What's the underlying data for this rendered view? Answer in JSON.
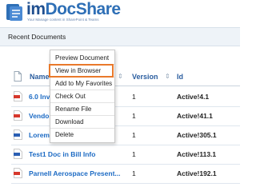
{
  "brand": {
    "name_prefix": "im",
    "name_rest": "DocShare",
    "tagline": "Your Manage content in SharePoint & Teams"
  },
  "breadcrumb": "Recent Documents",
  "table": {
    "columns": [
      "Name",
      "Version",
      "Id"
    ],
    "rows": [
      {
        "name": "6.0 Inve",
        "version": "1",
        "id": "Active!4.1"
      },
      {
        "name": "Vendor",
        "version": "1",
        "id": "Active!41.1"
      },
      {
        "name": "Lorem ip",
        "version": "1",
        "id": "Active!305.1"
      },
      {
        "name": "Test1 Doc in Bill Info",
        "version": "1",
        "id": "Active!113.1"
      },
      {
        "name": "Parnell Aerospace Present...",
        "version": "1",
        "id": "Active!192.1"
      }
    ]
  },
  "context_menu": {
    "items": [
      "Preview Document",
      "View in Browser",
      "Add to My Favorites",
      "Check Out",
      "Rename File",
      "Download",
      "Delete"
    ],
    "highlighted": "View in Browser"
  },
  "colors": {
    "brand_blue": "#2e6fb6",
    "link_blue": "#1d6bc4",
    "highlight_orange": "#e9792b",
    "pdf_red": "#d6382c",
    "word_blue": "#2b5fb3"
  }
}
